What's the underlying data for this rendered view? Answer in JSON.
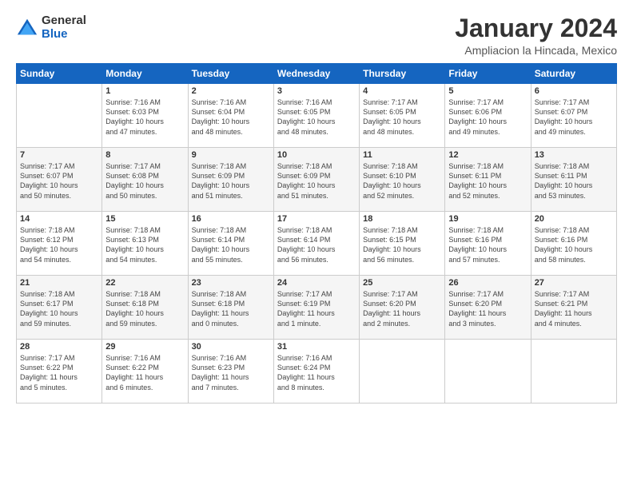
{
  "logo": {
    "general": "General",
    "blue": "Blue"
  },
  "title": "January 2024",
  "subtitle": "Ampliacion la Hincada, Mexico",
  "days_of_week": [
    "Sunday",
    "Monday",
    "Tuesday",
    "Wednesday",
    "Thursday",
    "Friday",
    "Saturday"
  ],
  "weeks": [
    [
      {
        "day": "",
        "info": ""
      },
      {
        "day": "1",
        "info": "Sunrise: 7:16 AM\nSunset: 6:03 PM\nDaylight: 10 hours\nand 47 minutes."
      },
      {
        "day": "2",
        "info": "Sunrise: 7:16 AM\nSunset: 6:04 PM\nDaylight: 10 hours\nand 48 minutes."
      },
      {
        "day": "3",
        "info": "Sunrise: 7:16 AM\nSunset: 6:05 PM\nDaylight: 10 hours\nand 48 minutes."
      },
      {
        "day": "4",
        "info": "Sunrise: 7:17 AM\nSunset: 6:05 PM\nDaylight: 10 hours\nand 48 minutes."
      },
      {
        "day": "5",
        "info": "Sunrise: 7:17 AM\nSunset: 6:06 PM\nDaylight: 10 hours\nand 49 minutes."
      },
      {
        "day": "6",
        "info": "Sunrise: 7:17 AM\nSunset: 6:07 PM\nDaylight: 10 hours\nand 49 minutes."
      }
    ],
    [
      {
        "day": "7",
        "info": "Sunrise: 7:17 AM\nSunset: 6:07 PM\nDaylight: 10 hours\nand 50 minutes."
      },
      {
        "day": "8",
        "info": "Sunrise: 7:17 AM\nSunset: 6:08 PM\nDaylight: 10 hours\nand 50 minutes."
      },
      {
        "day": "9",
        "info": "Sunrise: 7:18 AM\nSunset: 6:09 PM\nDaylight: 10 hours\nand 51 minutes."
      },
      {
        "day": "10",
        "info": "Sunrise: 7:18 AM\nSunset: 6:09 PM\nDaylight: 10 hours\nand 51 minutes."
      },
      {
        "day": "11",
        "info": "Sunrise: 7:18 AM\nSunset: 6:10 PM\nDaylight: 10 hours\nand 52 minutes."
      },
      {
        "day": "12",
        "info": "Sunrise: 7:18 AM\nSunset: 6:11 PM\nDaylight: 10 hours\nand 52 minutes."
      },
      {
        "day": "13",
        "info": "Sunrise: 7:18 AM\nSunset: 6:11 PM\nDaylight: 10 hours\nand 53 minutes."
      }
    ],
    [
      {
        "day": "14",
        "info": "Sunrise: 7:18 AM\nSunset: 6:12 PM\nDaylight: 10 hours\nand 54 minutes."
      },
      {
        "day": "15",
        "info": "Sunrise: 7:18 AM\nSunset: 6:13 PM\nDaylight: 10 hours\nand 54 minutes."
      },
      {
        "day": "16",
        "info": "Sunrise: 7:18 AM\nSunset: 6:14 PM\nDaylight: 10 hours\nand 55 minutes."
      },
      {
        "day": "17",
        "info": "Sunrise: 7:18 AM\nSunset: 6:14 PM\nDaylight: 10 hours\nand 56 minutes."
      },
      {
        "day": "18",
        "info": "Sunrise: 7:18 AM\nSunset: 6:15 PM\nDaylight: 10 hours\nand 56 minutes."
      },
      {
        "day": "19",
        "info": "Sunrise: 7:18 AM\nSunset: 6:16 PM\nDaylight: 10 hours\nand 57 minutes."
      },
      {
        "day": "20",
        "info": "Sunrise: 7:18 AM\nSunset: 6:16 PM\nDaylight: 10 hours\nand 58 minutes."
      }
    ],
    [
      {
        "day": "21",
        "info": "Sunrise: 7:18 AM\nSunset: 6:17 PM\nDaylight: 10 hours\nand 59 minutes."
      },
      {
        "day": "22",
        "info": "Sunrise: 7:18 AM\nSunset: 6:18 PM\nDaylight: 10 hours\nand 59 minutes."
      },
      {
        "day": "23",
        "info": "Sunrise: 7:18 AM\nSunset: 6:18 PM\nDaylight: 11 hours\nand 0 minutes."
      },
      {
        "day": "24",
        "info": "Sunrise: 7:17 AM\nSunset: 6:19 PM\nDaylight: 11 hours\nand 1 minute."
      },
      {
        "day": "25",
        "info": "Sunrise: 7:17 AM\nSunset: 6:20 PM\nDaylight: 11 hours\nand 2 minutes."
      },
      {
        "day": "26",
        "info": "Sunrise: 7:17 AM\nSunset: 6:20 PM\nDaylight: 11 hours\nand 3 minutes."
      },
      {
        "day": "27",
        "info": "Sunrise: 7:17 AM\nSunset: 6:21 PM\nDaylight: 11 hours\nand 4 minutes."
      }
    ],
    [
      {
        "day": "28",
        "info": "Sunrise: 7:17 AM\nSunset: 6:22 PM\nDaylight: 11 hours\nand 5 minutes."
      },
      {
        "day": "29",
        "info": "Sunrise: 7:16 AM\nSunset: 6:22 PM\nDaylight: 11 hours\nand 6 minutes."
      },
      {
        "day": "30",
        "info": "Sunrise: 7:16 AM\nSunset: 6:23 PM\nDaylight: 11 hours\nand 7 minutes."
      },
      {
        "day": "31",
        "info": "Sunrise: 7:16 AM\nSunset: 6:24 PM\nDaylight: 11 hours\nand 8 minutes."
      },
      {
        "day": "",
        "info": ""
      },
      {
        "day": "",
        "info": ""
      },
      {
        "day": "",
        "info": ""
      }
    ]
  ]
}
